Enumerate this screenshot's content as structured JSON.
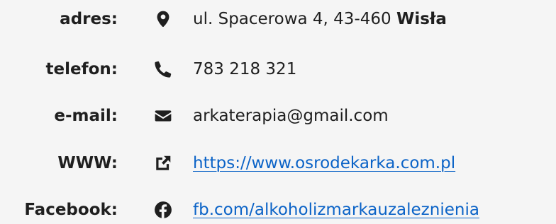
{
  "contact": {
    "address": {
      "label": "adres:",
      "street": "ul. Spacerowa 4, 43-460",
      "city": "Wisła",
      "icon": "map-marker-icon"
    },
    "phone": {
      "label": "telefon:",
      "value": "783 218 321",
      "icon": "phone-icon"
    },
    "email": {
      "label": "e-mail:",
      "value": "arkaterapia@gmail.com",
      "icon": "envelope-icon"
    },
    "website": {
      "label": "WWW:",
      "value": "https://www.osrodekarka.com.pl",
      "icon": "external-link-icon"
    },
    "facebook": {
      "label": "Facebook:",
      "value": "fb.com/alkoholizmarkauzaleznienia",
      "icon": "facebook-icon"
    }
  },
  "colors": {
    "background": "#f5f5f5",
    "text": "#1f1f1f",
    "link": "#0b63c7"
  }
}
